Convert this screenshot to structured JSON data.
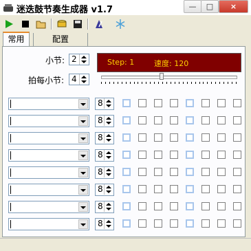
{
  "window": {
    "title": "迷迭鼓节奏生成器 v1.7",
    "buttons": {
      "minimize": "—",
      "maximize": "□",
      "close": "×"
    }
  },
  "toolbar": {
    "icons": [
      "play-icon",
      "stop-icon",
      "open-folder-icon",
      "drum-icon",
      "save-icon",
      "metronome-icon",
      "snowflake-icon"
    ]
  },
  "tabs": [
    "常用",
    "配置"
  ],
  "settings": {
    "measure_label": "小节:",
    "measure_value": "2",
    "beats_label": "拍每小节:",
    "beats_value": "4"
  },
  "display": {
    "step_text": "Step:  1",
    "speed_text": "速度:  120",
    "text_color": "#ffd000",
    "background_color": "#800000"
  },
  "slider": {
    "position_fraction": 0.45,
    "tick_count": 34
  },
  "tracks": [
    {
      "instrument": "",
      "value": "8"
    },
    {
      "instrument": "",
      "value": "8"
    },
    {
      "instrument": "",
      "value": "8"
    },
    {
      "instrument": "",
      "value": "8"
    },
    {
      "instrument": "",
      "value": "8"
    },
    {
      "instrument": "",
      "value": "8"
    },
    {
      "instrument": "",
      "value": "8"
    },
    {
      "instrument": "",
      "value": "8"
    }
  ],
  "step_checkboxes": {
    "per_track": 8,
    "highlighted_steps": [
      0,
      4
    ],
    "checked": []
  }
}
